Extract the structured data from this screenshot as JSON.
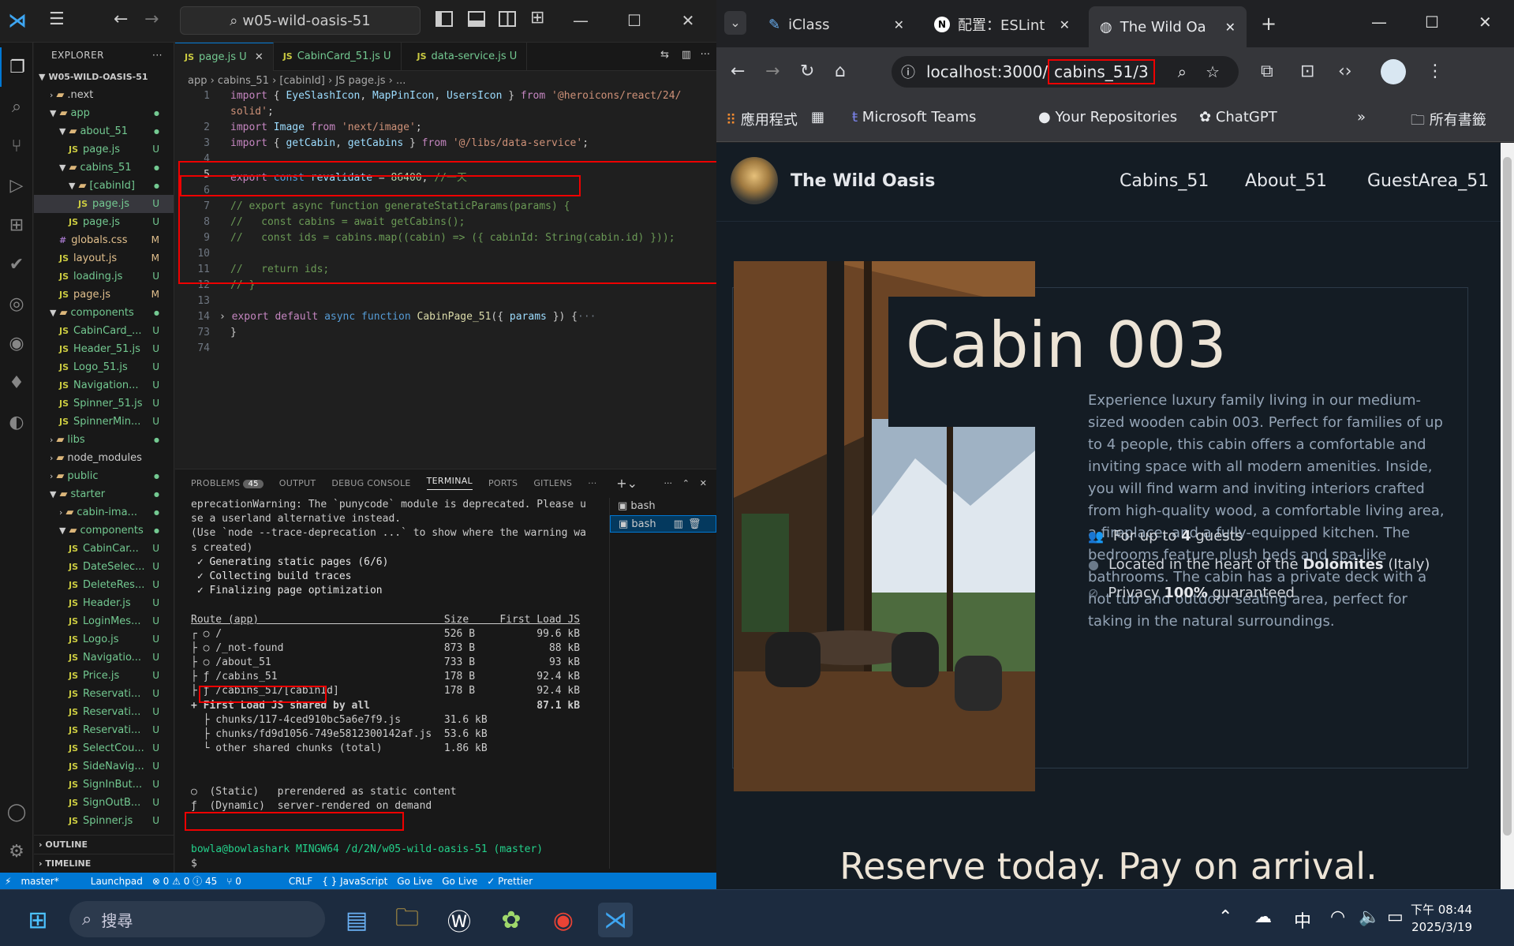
{
  "vscode": {
    "search": "w05-wild-oasis-51",
    "explorer_title": "EXPLORER",
    "project": "W05-WILD-OASIS-51",
    "tree": [
      {
        "name": ".next",
        "kind": "folder",
        "depth": 1,
        "open": false,
        "status": "",
        "cls": ""
      },
      {
        "name": "app",
        "kind": "folder",
        "depth": 1,
        "open": true,
        "status": "",
        "cls": "un"
      },
      {
        "name": "about_51",
        "kind": "folder",
        "depth": 2,
        "open": true,
        "status": "",
        "cls": "un"
      },
      {
        "name": "page.js",
        "kind": "js",
        "depth": 3,
        "status": "U",
        "cls": "un"
      },
      {
        "name": "cabins_51",
        "kind": "folder",
        "depth": 2,
        "open": true,
        "status": "",
        "cls": "un"
      },
      {
        "name": "[cabinId]",
        "kind": "folder",
        "depth": 3,
        "open": true,
        "status": "",
        "cls": "un"
      },
      {
        "name": "page.js",
        "kind": "js",
        "depth": 4,
        "status": "U",
        "cls": "un sel"
      },
      {
        "name": "page.js",
        "kind": "js",
        "depth": 3,
        "status": "U",
        "cls": "un"
      },
      {
        "name": "globals.css",
        "kind": "css",
        "depth": 2,
        "status": "M",
        "cls": "mod"
      },
      {
        "name": "layout.js",
        "kind": "js",
        "depth": 2,
        "status": "M",
        "cls": "mod"
      },
      {
        "name": "loading.js",
        "kind": "js",
        "depth": 2,
        "status": "U",
        "cls": "un"
      },
      {
        "name": "page.js",
        "kind": "js",
        "depth": 2,
        "status": "M",
        "cls": "mod"
      },
      {
        "name": "components",
        "kind": "folder",
        "depth": 1,
        "open": true,
        "status": "",
        "cls": "un"
      },
      {
        "name": "CabinCard_...",
        "kind": "js",
        "depth": 2,
        "status": "U",
        "cls": "un"
      },
      {
        "name": "Header_51.js",
        "kind": "js",
        "depth": 2,
        "status": "U",
        "cls": "un"
      },
      {
        "name": "Logo_51.js",
        "kind": "js",
        "depth": 2,
        "status": "U",
        "cls": "un"
      },
      {
        "name": "Navigation...",
        "kind": "js",
        "depth": 2,
        "status": "U",
        "cls": "un"
      },
      {
        "name": "Spinner_51.js",
        "kind": "js",
        "depth": 2,
        "status": "U",
        "cls": "un"
      },
      {
        "name": "SpinnerMin...",
        "kind": "js",
        "depth": 2,
        "status": "U",
        "cls": "un"
      },
      {
        "name": "libs",
        "kind": "folder",
        "depth": 1,
        "open": false,
        "status": "",
        "cls": "un"
      },
      {
        "name": "node_modules",
        "kind": "folder",
        "depth": 1,
        "open": false,
        "status": "",
        "cls": ""
      },
      {
        "name": "public",
        "kind": "folder",
        "depth": 1,
        "open": false,
        "status": "",
        "cls": "un"
      },
      {
        "name": "starter",
        "kind": "folder",
        "depth": 1,
        "open": true,
        "status": "",
        "cls": "un"
      },
      {
        "name": "cabin-ima...",
        "kind": "folder",
        "depth": 2,
        "open": false,
        "status": "",
        "cls": "un"
      },
      {
        "name": "components",
        "kind": "folder",
        "depth": 2,
        "open": true,
        "status": "",
        "cls": "un"
      },
      {
        "name": "CabinCar...",
        "kind": "js",
        "depth": 3,
        "status": "U",
        "cls": "un"
      },
      {
        "name": "DateSelec...",
        "kind": "js",
        "depth": 3,
        "status": "U",
        "cls": "un"
      },
      {
        "name": "DeleteRes...",
        "kind": "js",
        "depth": 3,
        "status": "U",
        "cls": "un"
      },
      {
        "name": "Header.js",
        "kind": "js",
        "depth": 3,
        "status": "U",
        "cls": "un"
      },
      {
        "name": "LoginMes...",
        "kind": "js",
        "depth": 3,
        "status": "U",
        "cls": "un"
      },
      {
        "name": "Logo.js",
        "kind": "js",
        "depth": 3,
        "status": "U",
        "cls": "un"
      },
      {
        "name": "Navigatio...",
        "kind": "js",
        "depth": 3,
        "status": "U",
        "cls": "un"
      },
      {
        "name": "Price.js",
        "kind": "js",
        "depth": 3,
        "status": "U",
        "cls": "un"
      },
      {
        "name": "Reservati...",
        "kind": "js",
        "depth": 3,
        "status": "U",
        "cls": "un"
      },
      {
        "name": "Reservati...",
        "kind": "js",
        "depth": 3,
        "status": "U",
        "cls": "un"
      },
      {
        "name": "Reservati...",
        "kind": "js",
        "depth": 3,
        "status": "U",
        "cls": "un"
      },
      {
        "name": "SelectCou...",
        "kind": "js",
        "depth": 3,
        "status": "U",
        "cls": "un"
      },
      {
        "name": "SideNavig...",
        "kind": "js",
        "depth": 3,
        "status": "U",
        "cls": "un"
      },
      {
        "name": "SignInBut...",
        "kind": "js",
        "depth": 3,
        "status": "U",
        "cls": "un"
      },
      {
        "name": "SignOutB...",
        "kind": "js",
        "depth": 3,
        "status": "U",
        "cls": "un"
      },
      {
        "name": "Spinner.js",
        "kind": "js",
        "depth": 3,
        "status": "U",
        "cls": "un"
      }
    ],
    "outline": "OUTLINE",
    "timeline": "TIMELINE",
    "tabs": [
      {
        "label": "page.js",
        "badge": "U"
      },
      {
        "label": "CabinCard_51.js",
        "badge": "U"
      },
      {
        "label": "data-service.js",
        "badge": "U"
      }
    ],
    "breadcrumb": "app › cabins_51 › [cabinId] › JS page.js › ...",
    "panel_tabs": [
      "PROBLEMS",
      "OUTPUT",
      "DEBUG CONSOLE",
      "TERMINAL",
      "PORTS",
      "GITLENS"
    ],
    "problems_count": "45",
    "terminal": [
      "eprecationWarning: The `punycode` module is deprecated. Please u",
      "se a userland alternative instead.",
      "(Use `node --trace-deprecation ...` to show where the warning wa",
      "s created)",
      " ✓ Generating static pages (6/6)",
      " ✓ Collecting build traces",
      " ✓ Finalizing page optimization",
      "",
      "Route (app)                              Size     First Load JS",
      "┌ ○ /                                    526 B          99.6 kB",
      "├ ○ /_not-found                          873 B            88 kB",
      "├ ○ /about_51                            733 B            93 kB",
      "├ ƒ /cabins_51                           178 B          92.4 kB",
      "├ ƒ /cabins_51/[cabinId]                 178 B          92.4 kB",
      "+ First Load JS shared by all                           87.1 kB",
      "  ├ chunks/117-4ced910bc5a6e7f9.js       31.6 kB",
      "  ├ chunks/fd9d1056-749e5812300142af.js  53.6 kB",
      "  └ other shared chunks (total)          1.86 kB",
      "",
      "",
      "○  (Static)   prerendered as static content",
      "ƒ  (Dynamic)  server-rendered on demand",
      "",
      "",
      "bowla@bowlashark MINGW64 /d/2N/w05-wild-oasis-51 (master)",
      "$ "
    ],
    "shells": [
      "bash",
      "bash"
    ],
    "status_items": [
      "master*",
      "Launchpad",
      "⊗ 0 ⚠ 0 ⓘ 45",
      "⑂ 0",
      "CRLF",
      "{ } JavaScript",
      "Go Live",
      "Go Live",
      "✓ Prettier"
    ]
  },
  "chrome": {
    "tabs": [
      "iClass",
      "配置：ESLint",
      "The Wild Oa"
    ],
    "url_host": "localhost:3000/",
    "url_path": "cabins_51/3",
    "bookmarks": [
      "應用程式",
      "Microsoft Teams",
      "Your Repositories",
      "ChatGPT",
      "所有書籤"
    ]
  },
  "site": {
    "brand": "The Wild Oasis",
    "nav": [
      "Cabins_51",
      "About_51",
      "GuestArea_51"
    ],
    "title": "Cabin 003",
    "description": "Experience luxury family living in our medium-sized wooden cabin 003. Perfect for families of up to 4 people, this cabin offers a comfortable and inviting space with all modern amenities. Inside, you will find warm and inviting interiors crafted from high-quality wood, a comfortable living area, a fireplace, and a fully-equipped kitchen. The bedrooms feature plush beds and spa-like bathrooms. The cabin has a private deck with a hot tub and outdoor seating area, perfect for taking in the natural surroundings.",
    "feature1": {
      "pre": "For up to ",
      "bold": "4",
      "post": " guests"
    },
    "feature2": {
      "pre": "Located in the heart of the ",
      "bold": "Dolomites",
      "post": " (Italy)"
    },
    "feature3": {
      "pre": "Privacy ",
      "bold": "100%",
      "post": " guaranteed"
    },
    "reserve": "Reserve today. Pay on arrival."
  },
  "taskbar": {
    "search": "搜尋",
    "ime": "中",
    "time": "下午 08:44",
    "date": "2025/3/19"
  }
}
